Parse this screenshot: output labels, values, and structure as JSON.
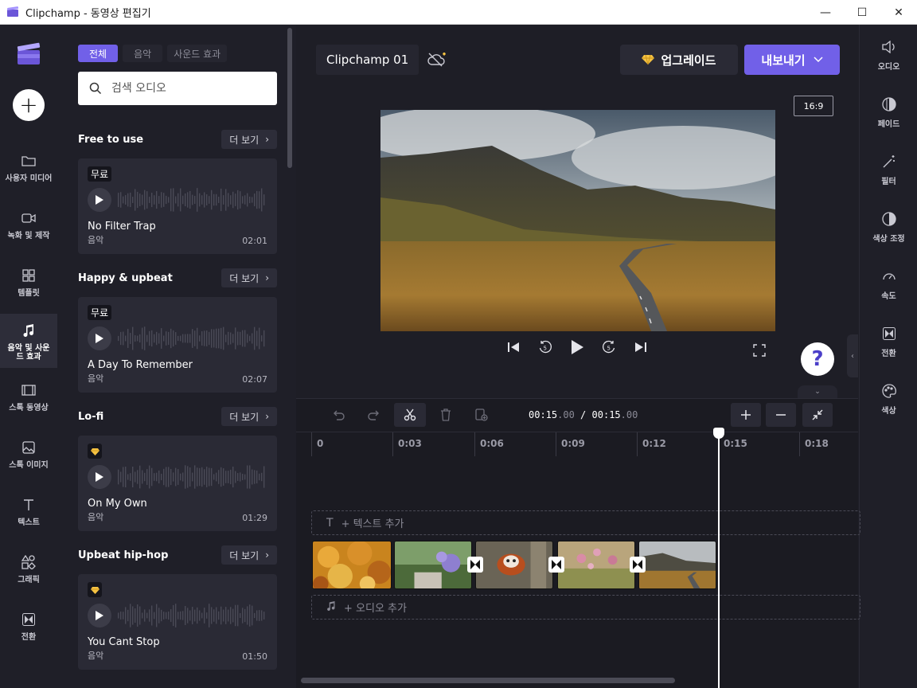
{
  "window": {
    "title": "Clipchamp - 동영상 편집기",
    "minimize": "—",
    "maximize": "☐",
    "close": "✕"
  },
  "nav": {
    "items": [
      {
        "label": "사용자 미디어",
        "icon": "folder-icon"
      },
      {
        "label": "녹화 및 제작",
        "icon": "camera-icon"
      },
      {
        "label": "템플릿",
        "icon": "template-icon"
      },
      {
        "label": "음악 및 사운드 효과",
        "icon": "music-note-icon",
        "active": true
      },
      {
        "label": "스톡 동영상",
        "icon": "film-icon"
      },
      {
        "label": "스톡 이미지",
        "icon": "image-icon"
      },
      {
        "label": "텍스트",
        "icon": "text-icon"
      },
      {
        "label": "그래픽",
        "icon": "shapes-icon"
      },
      {
        "label": "전환",
        "icon": "transition-icon"
      }
    ]
  },
  "panel": {
    "tabs": [
      "전체",
      "음악",
      "사운드 효과"
    ],
    "search_placeholder": "검색 오디오",
    "more_label": "더 보기",
    "sections": [
      {
        "title": "Free to use",
        "track": {
          "badge": "무료",
          "name": "No Filter Trap",
          "type": "음악",
          "duration": "02:01"
        }
      },
      {
        "title": "Happy & upbeat",
        "track": {
          "badge": "무료",
          "name": "A Day To Remember",
          "type": "음악",
          "duration": "02:07"
        }
      },
      {
        "title": "Lo-fi",
        "track": {
          "badge": "premium-gem-icon",
          "name": "On My Own",
          "type": "음악",
          "duration": "01:29"
        }
      },
      {
        "title": "Upbeat hip-hop",
        "track": {
          "badge": "premium-gem-icon",
          "name": "You Cant Stop",
          "type": "음악",
          "duration": "01:50"
        }
      }
    ]
  },
  "editor": {
    "project_name": "Clipchamp 01",
    "upgrade_label": "업그레이드",
    "export_label": "내보내기",
    "aspect_ratio": "16:9",
    "help": "?"
  },
  "rightrail": {
    "items": [
      {
        "label": "오디오",
        "icon": "speaker-icon"
      },
      {
        "label": "페이드",
        "icon": "fade-icon"
      },
      {
        "label": "필터",
        "icon": "magic-wand-icon"
      },
      {
        "label": "색상 조정",
        "icon": "contrast-icon"
      },
      {
        "label": "속도",
        "icon": "speedometer-icon"
      },
      {
        "label": "전환",
        "icon": "transition-icon"
      },
      {
        "label": "색상",
        "icon": "palette-icon"
      }
    ]
  },
  "timeline": {
    "current_time": "00:15",
    "current_frac": ".00",
    "separator": "/",
    "total_time": "00:15",
    "total_frac": ".00",
    "ticks": [
      "0",
      "0:03",
      "0:06",
      "0:09",
      "0:12",
      "0:15",
      "0:18"
    ],
    "add_text": "+ 텍스트 추가",
    "add_audio": "+ 오디오 추가"
  },
  "colors": {
    "accent": "#7160e8",
    "background": "#1e1e26",
    "panel": "#1f1f28",
    "card": "#2a2a35",
    "premium": "#f5c242"
  }
}
